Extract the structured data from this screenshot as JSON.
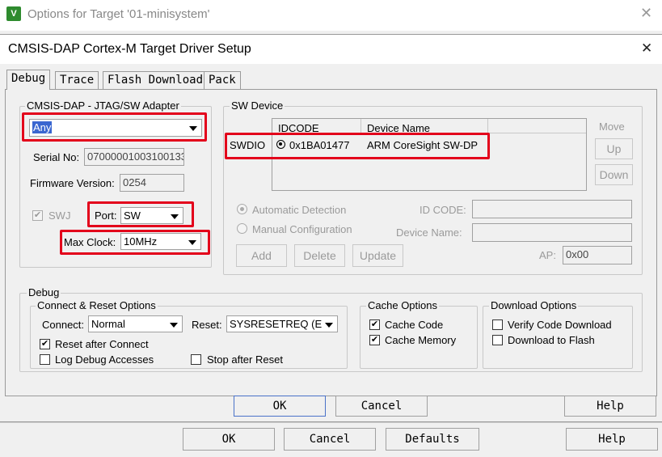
{
  "outer_window": {
    "icon_text": "V",
    "title": "Options for Target '01-minisystem'",
    "close_glyph": "✕",
    "buttons": {
      "ok": "OK",
      "cancel": "Cancel",
      "defaults": "Defaults",
      "help": "Help"
    }
  },
  "dialog": {
    "title": "CMSIS-DAP Cortex-M Target Driver Setup",
    "close_glyph": "✕",
    "tabs": [
      "Debug",
      "Trace",
      "Flash Download",
      "Pack"
    ],
    "active_tab": "Debug",
    "buttons": {
      "ok": "OK",
      "cancel": "Cancel",
      "help": "Help"
    }
  },
  "adapter": {
    "group_label": "CMSIS-DAP - JTAG/SW Adapter",
    "selected": "Any",
    "serial_label": "Serial No:",
    "serial_value": "07000001003100133",
    "firmware_label": "Firmware Version:",
    "firmware_value": "0254",
    "swj_label": "SWJ",
    "swj_checked": true,
    "port_label": "Port:",
    "port_value": "SW",
    "max_clock_label": "Max Clock:",
    "max_clock_value": "10MHz"
  },
  "sw_device": {
    "group_label": "SW Device",
    "columns": [
      "IDCODE",
      "Device Name"
    ],
    "row_label": "SWDIO",
    "rows": [
      {
        "idcode": "0x1BA01477",
        "device_name": "ARM CoreSight SW-DP"
      }
    ],
    "move_label": "Move",
    "up_label": "Up",
    "down_label": "Down",
    "auto_detect_label": "Automatic Detection",
    "manual_config_label": "Manual Configuration",
    "id_code_label": "ID CODE:",
    "device_name_label": "Device Name:",
    "ap_label": "AP:",
    "ap_value": "0x00",
    "add_label": "Add",
    "delete_label": "Delete",
    "update_label": "Update"
  },
  "debug": {
    "group_label": "Debug",
    "connect_reset": {
      "group_label": "Connect & Reset Options",
      "connect_label": "Connect:",
      "connect_value": "Normal",
      "reset_label": "Reset:",
      "reset_value": "SYSRESETREQ (E",
      "reset_after_connect_label": "Reset after Connect",
      "reset_after_connect_checked": true,
      "log_debug_label": "Log Debug Accesses",
      "log_debug_checked": false,
      "stop_after_reset_label": "Stop after Reset",
      "stop_after_reset_checked": false
    },
    "cache": {
      "group_label": "Cache Options",
      "cache_code_label": "Cache Code",
      "cache_code_checked": true,
      "cache_memory_label": "Cache Memory",
      "cache_memory_checked": true
    },
    "download": {
      "group_label": "Download Options",
      "verify_label": "Verify Code Download",
      "verify_checked": false,
      "to_flash_label": "Download to Flash",
      "to_flash_checked": false
    }
  },
  "colors": {
    "highlight_red": "#e3001b",
    "selection_blue": "#3a66d0"
  }
}
